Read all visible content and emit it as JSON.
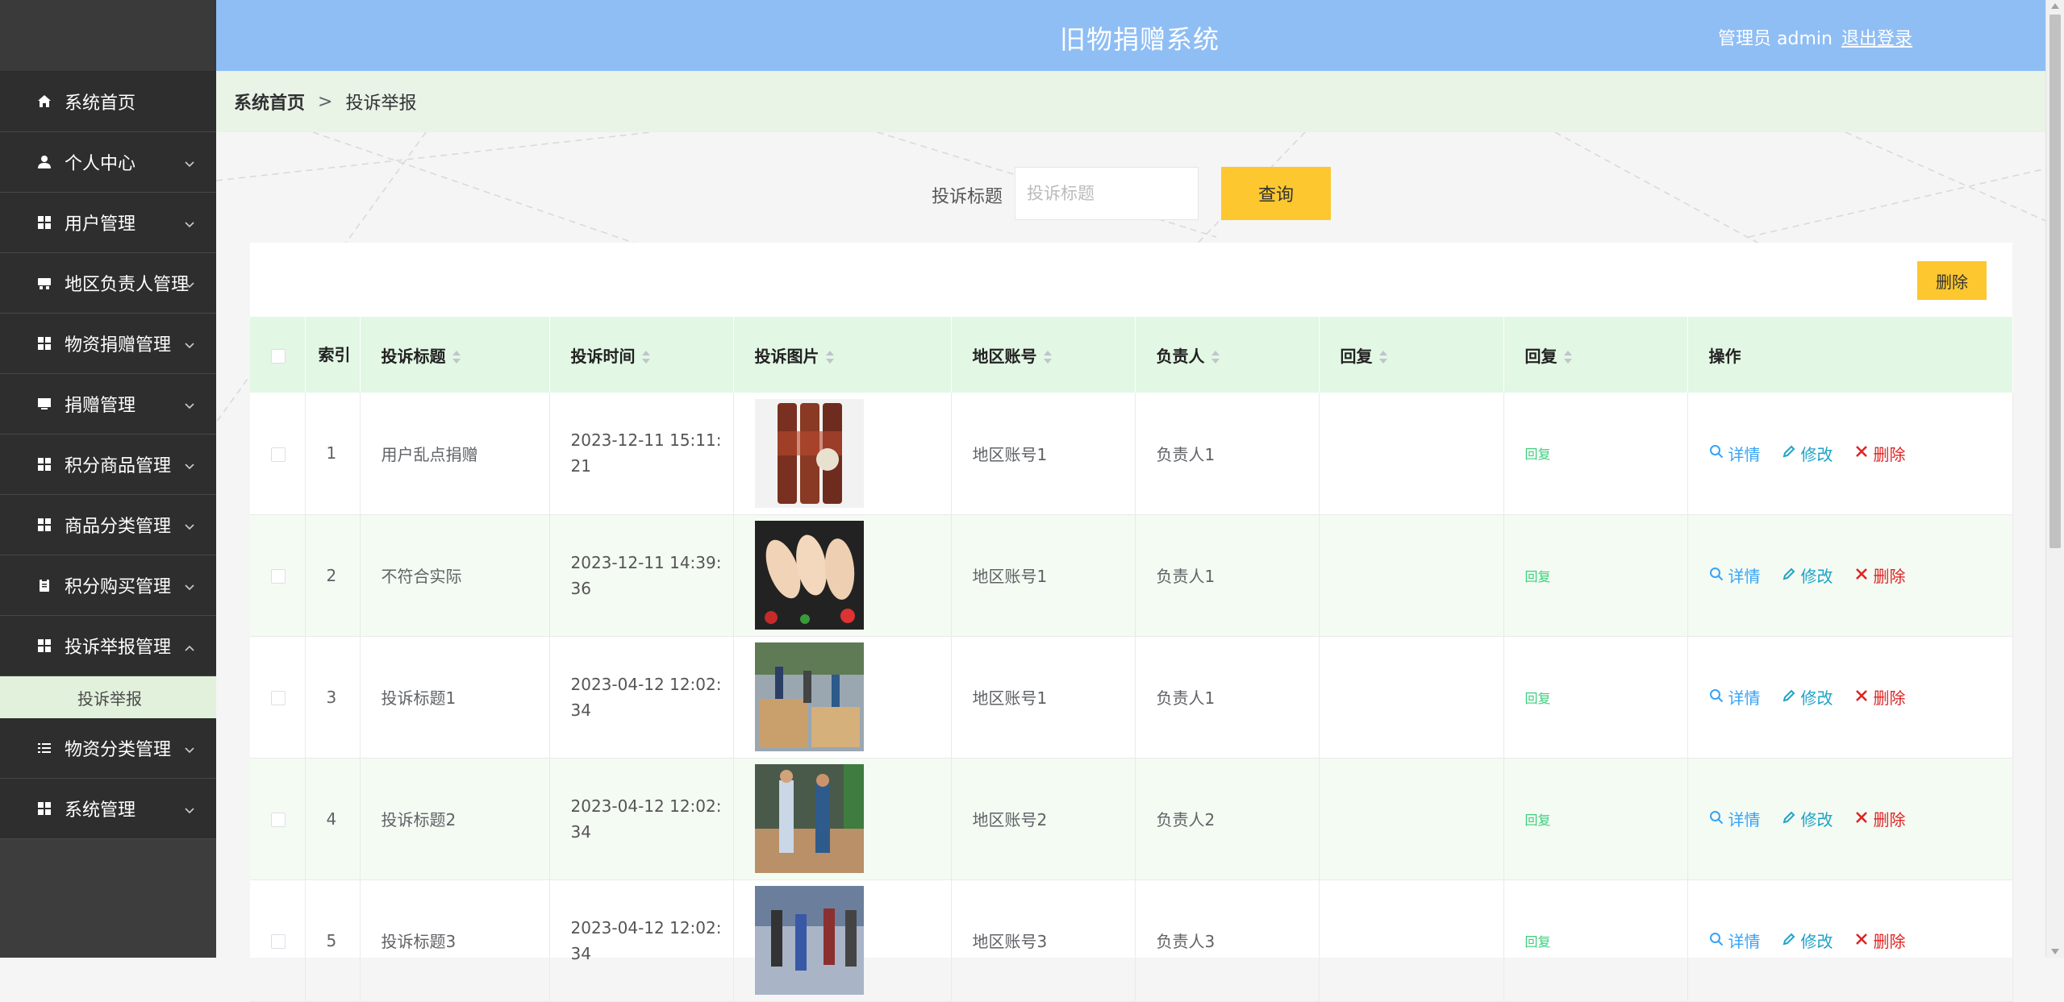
{
  "app": {
    "title": "旧物捐赠系统",
    "user": "管理员 admin",
    "logout": "退出登录"
  },
  "sidebar": {
    "items": [
      {
        "label": "系统首页",
        "icon": "home-icon",
        "chevron": false
      },
      {
        "label": "个人中心",
        "icon": "user-icon",
        "chevron": true
      },
      {
        "label": "用户管理",
        "icon": "grid-icon",
        "chevron": true
      },
      {
        "label": "地区负责人管理",
        "icon": "inbox-icon",
        "chevron": true
      },
      {
        "label": "物资捐赠管理",
        "icon": "grid-icon",
        "chevron": true
      },
      {
        "label": "捐赠管理",
        "icon": "monitor-icon",
        "chevron": true
      },
      {
        "label": "积分商品管理",
        "icon": "grid-icon",
        "chevron": true
      },
      {
        "label": "商品分类管理",
        "icon": "grid-icon",
        "chevron": true
      },
      {
        "label": "积分购买管理",
        "icon": "clipboard-icon",
        "chevron": true
      },
      {
        "label": "投诉举报管理",
        "icon": "grid-icon",
        "chevron": true,
        "expanded": true
      },
      {
        "label": "物资分类管理",
        "icon": "list-icon",
        "chevron": true
      },
      {
        "label": "系统管理",
        "icon": "grid-icon",
        "chevron": true
      }
    ],
    "subitem": "投诉举报"
  },
  "breadcrumb": {
    "home": "系统首页",
    "sep": ">",
    "current": "投诉举报"
  },
  "search": {
    "label": "投诉标题",
    "placeholder": "投诉标题",
    "button": "查询"
  },
  "toolbar": {
    "delete": "删除"
  },
  "table": {
    "headers": [
      "索引",
      "投诉标题",
      "投诉时间",
      "投诉图片",
      "地区账号",
      "负责人",
      "回复",
      "回复",
      "操作"
    ],
    "rows": [
      {
        "idx": "1",
        "title": "用户乱点捐赠",
        "time1": "2023-12-11 15:11:",
        "time2": "21",
        "account": "地区账号1",
        "owner": "负责人1",
        "reply": "",
        "reply_link": "回复"
      },
      {
        "idx": "2",
        "title": "不符合实际",
        "time1": "2023-12-11 14:39:",
        "time2": "36",
        "account": "地区账号1",
        "owner": "负责人1",
        "reply": "",
        "reply_link": "回复"
      },
      {
        "idx": "3",
        "title": "投诉标题1",
        "time1": "2023-04-12 12:02:",
        "time2": "34",
        "account": "地区账号1",
        "owner": "负责人1",
        "reply": "",
        "reply_link": "回复"
      },
      {
        "idx": "4",
        "title": "投诉标题2",
        "time1": "2023-04-12 12:02:",
        "time2": "34",
        "account": "地区账号2",
        "owner": "负责人2",
        "reply": "",
        "reply_link": "回复"
      },
      {
        "idx": "5",
        "title": "投诉标题3",
        "time1": "2023-04-12 12:02:",
        "time2": "34",
        "account": "地区账号3",
        "owner": "负责人3",
        "reply": "",
        "reply_link": "回复"
      }
    ],
    "actions": {
      "detail": "详情",
      "edit": "修改",
      "delete": "删除"
    }
  },
  "colors": {
    "header": "#8fbef5",
    "accent": "#fcc72f",
    "sidebar": "#2e2e2e",
    "th": "#e2f7e4"
  }
}
